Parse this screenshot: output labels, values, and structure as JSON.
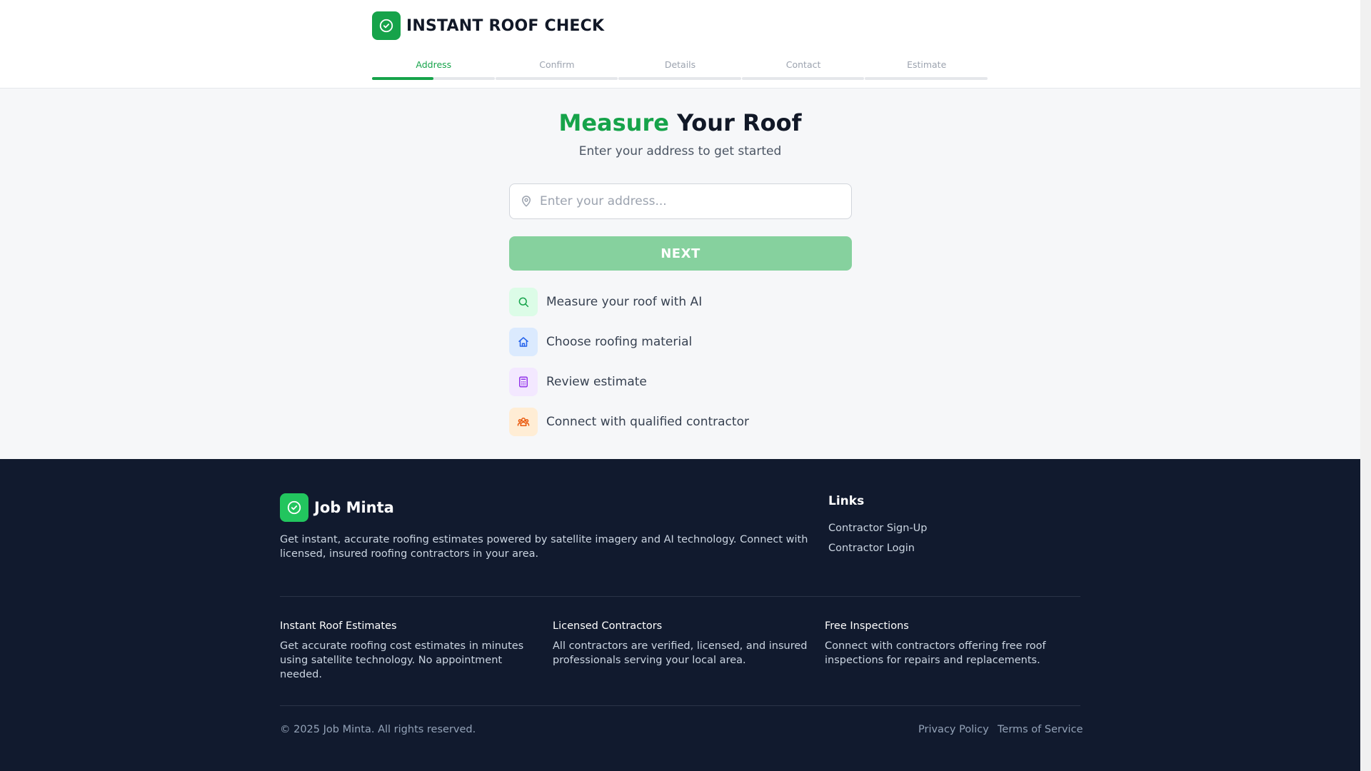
{
  "header": {
    "brand_name": "INSTANT ROOF CHECK",
    "brand_icon": "check-circle-icon",
    "steps": [
      {
        "label": "Address",
        "progress": 0.5,
        "active": true
      },
      {
        "label": "Confirm",
        "progress": 0,
        "active": false
      },
      {
        "label": "Details",
        "progress": 0,
        "active": false
      },
      {
        "label": "Contact",
        "progress": 0,
        "active": false
      },
      {
        "label": "Estimate",
        "progress": 0,
        "active": false
      }
    ]
  },
  "hero": {
    "title_accent": "Measure",
    "title_rest": "Your Roof",
    "subtitle": "Enter your address to get started"
  },
  "address": {
    "placeholder": "Enter your address...",
    "value": ""
  },
  "next_button": {
    "label": "NEXT"
  },
  "features": [
    {
      "label": "Measure your roof with AI",
      "icon": "search-icon",
      "bg": "#dcfce7",
      "color": "#16a34a"
    },
    {
      "label": "Choose roofing material",
      "icon": "home-icon",
      "bg": "#dbeafe",
      "color": "#2563eb"
    },
    {
      "label": "Review estimate",
      "icon": "calculator-icon",
      "bg": "#f3e8ff",
      "color": "#9333ea"
    },
    {
      "label": "Connect with qualified contractor",
      "icon": "users-icon",
      "bg": "#ffedd5",
      "color": "#ea580c"
    }
  ],
  "footer": {
    "brand_name": "Job Minta",
    "description": "Get instant, accurate roofing estimates powered by satellite imagery and AI technology. Connect with licensed, insured roofing contractors in your area.",
    "links_title": "Links",
    "links": [
      "Contractor Sign-Up",
      "Contractor Login"
    ],
    "columns": [
      {
        "title": "Instant Roof Estimates",
        "text": "Get accurate roofing cost estimates in minutes using satellite technology. No appointment needed."
      },
      {
        "title": "Licensed Contractors",
        "text": "All contractors are verified, licensed, and insured professionals serving your local area."
      },
      {
        "title": "Free Inspections",
        "text": "Connect with contractors offering free roof inspections for repairs and replacements."
      }
    ],
    "copyright": "© 2025 Job Minta. All rights reserved.",
    "privacy": "Privacy Policy",
    "terms": "Terms of Service"
  },
  "colors": {
    "accent": "#16a34a",
    "footer_bg": "#111a2e"
  }
}
